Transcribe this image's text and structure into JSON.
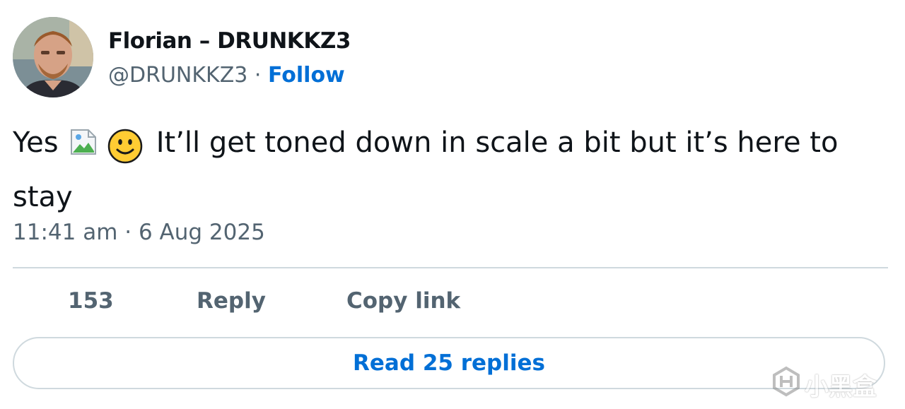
{
  "author": {
    "name": "Florian – DRUNKKZ3",
    "handle": "@DRUNKKZ3",
    "separator": "·",
    "follow_label": "Follow",
    "avatar_icon": "user-avatar-photo"
  },
  "tweet": {
    "text_before": "Yes",
    "broken_image_icon": "broken-image-icon",
    "emoji": "slightly-smiling-face",
    "text_after": "It’ll get toned down in scale a bit but it’s here to stay",
    "timestamp": "11:41 am · 6 Aug 2025"
  },
  "actions": {
    "likes_count": "153",
    "reply_label": "Reply",
    "copy_link_label": "Copy link"
  },
  "read_replies_label": "Read 25 replies",
  "watermark": {
    "text": "小黑盒",
    "logo_icon": "heybox-logo-icon"
  },
  "colors": {
    "link": "#006fd6",
    "secondary_text": "#536471",
    "border": "#cfd9de",
    "primary_text": "#0f1419"
  }
}
